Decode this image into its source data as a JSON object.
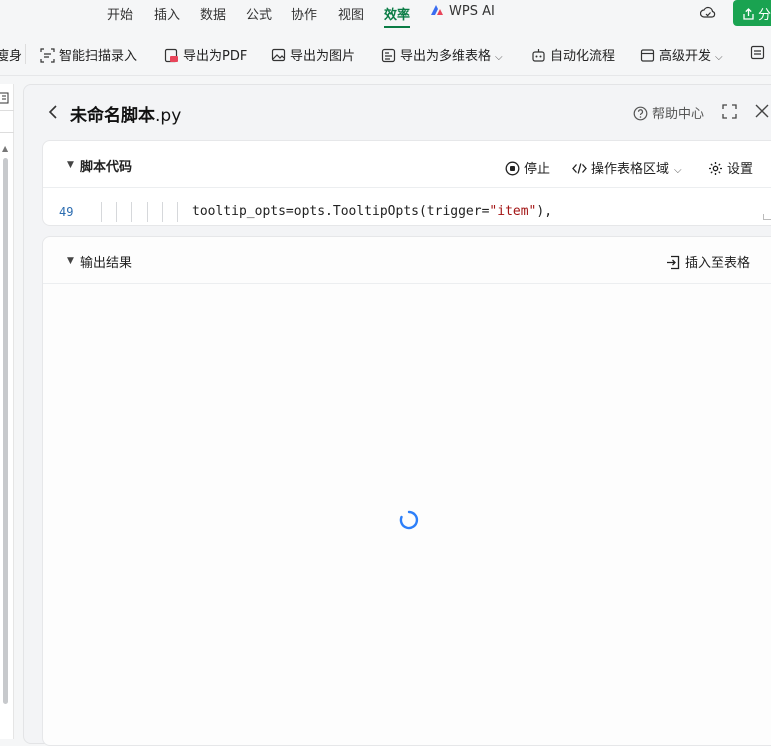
{
  "menu": {
    "items": [
      "开始",
      "插入",
      "数据",
      "公式",
      "协作",
      "视图",
      "效率"
    ],
    "active": "效率",
    "ai_label": "WPS AI",
    "share_label": "分"
  },
  "toolbar": {
    "partial_label": "瘦身",
    "smart_scan": "智能扫描录入",
    "export_pdf": "导出为PDF",
    "export_image": "导出为图片",
    "export_multitable": "导出为多维表格",
    "automation": "自动化流程",
    "advanced_dev": "高级开发"
  },
  "panel": {
    "title": "未命名脚本",
    "title_ext": ".py",
    "help": "帮助中心"
  },
  "script_section": {
    "title": "脚本代码",
    "stop": "停止",
    "operate_range": "操作表格区域",
    "settings": "设置"
  },
  "code": {
    "line_number": "49",
    "text_before": "tooltip_opts=opts.TooltipOpts(trigger=",
    "string_literal": "\"item\"",
    "text_after": "),"
  },
  "output_section": {
    "title": "输出结果",
    "insert": "插入至表格"
  },
  "colors": {
    "accent": "#0a7c45",
    "share_button": "#1aa351",
    "spinner": "#2d7ff9"
  }
}
